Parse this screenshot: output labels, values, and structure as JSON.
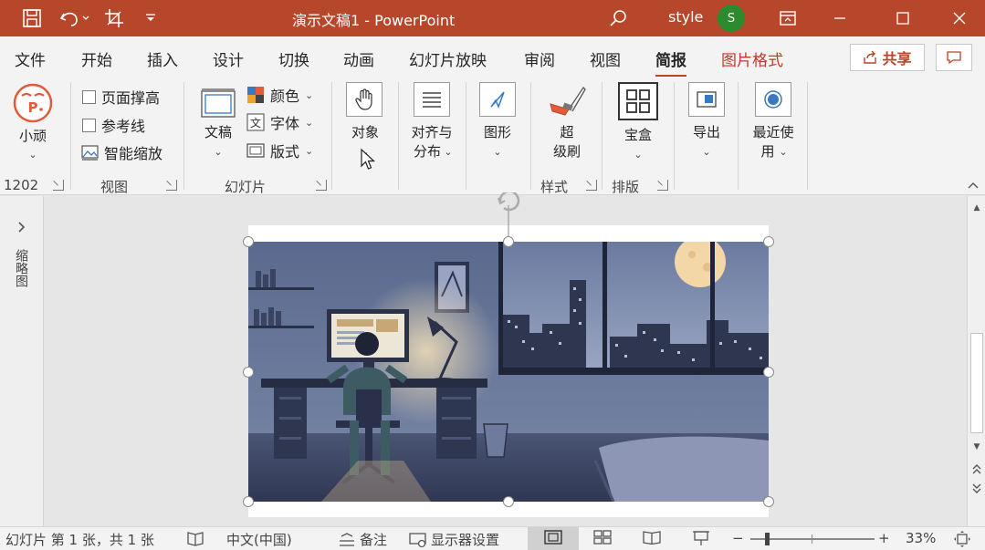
{
  "titlebar": {
    "doc_title": "演示文稿1  -  PowerPoint",
    "user_name": "style",
    "user_initial": "S",
    "icons": [
      "save-icon",
      "undo-icon",
      "crop-icon",
      "customize-qat-icon",
      "search-icon",
      "ribbon-display-icon",
      "minimize-icon",
      "maximize-icon",
      "close-icon"
    ]
  },
  "tabs": [
    "文件",
    "开始",
    "插入",
    "设计",
    "切换",
    "动画",
    "幻灯片放映",
    "审阅",
    "视图",
    "简报",
    "图片格式"
  ],
  "active_tab": "简报",
  "share_label": "共享",
  "ribbon": {
    "xiaowan": {
      "label": "小顽",
      "number": "1202"
    },
    "view_group": {
      "items": [
        "页面撑高",
        "参考线",
        "智能缩放"
      ],
      "label": "视图"
    },
    "slide_group": {
      "doc_label": "文稿",
      "items": [
        "颜色",
        "字体",
        "版式"
      ],
      "label": "幻灯片"
    },
    "object_label": "对象",
    "align_label_1": "对齐与",
    "align_label_2": "分布",
    "shape_label": "图形",
    "style_group": {
      "label_1": "超",
      "label_2": "级刷",
      "group_label": "样式"
    },
    "layout_group": {
      "button_label": "宝盒",
      "group_label": "排版"
    },
    "export_label": "导出",
    "recent_label_1": "最近使",
    "recent_label_2": "用"
  },
  "left_pane": {
    "label": "缩略图"
  },
  "statusbar": {
    "slide_info": "幻灯片 第 1 张，共 1 张",
    "language": "中文(中国)",
    "notes": "备注",
    "display_settings": "显示器设置",
    "zoom_minus": "−",
    "zoom_plus": "+",
    "zoom_level": "33%"
  },
  "colors": {
    "accent": "#b7472a",
    "title_bar": "#b7472a",
    "avatar": "#2c8b2c"
  }
}
